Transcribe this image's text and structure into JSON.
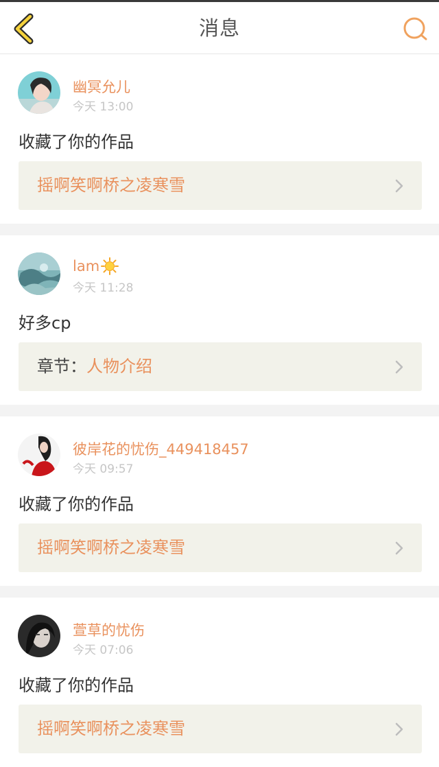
{
  "header": {
    "title": "消息",
    "back_icon": "chevron-left-icon",
    "search_icon": "search-icon",
    "accent_color": "#e9915d"
  },
  "messages": [
    {
      "username": "幽冥允儿",
      "time": "今天 13:00",
      "text": "收藏了你的作品",
      "link_prefix": "",
      "link_text": "摇啊笑啊桥之凌寒雪"
    },
    {
      "username": "lam",
      "username_emoji": "sun-icon",
      "time": "今天 11:28",
      "text": "好多cp",
      "link_prefix": "章节：",
      "link_text": "人物介绍"
    },
    {
      "username": "彼岸花的忧伤_449418457",
      "time": "今天 09:57",
      "text": "收藏了你的作品",
      "link_prefix": "",
      "link_text": "摇啊笑啊桥之凌寒雪"
    },
    {
      "username": "萱草的忧伤",
      "time": "今天 07:06",
      "text": "收藏了你的作品",
      "link_prefix": "",
      "link_text": "摇啊笑啊桥之凌寒雪"
    }
  ]
}
